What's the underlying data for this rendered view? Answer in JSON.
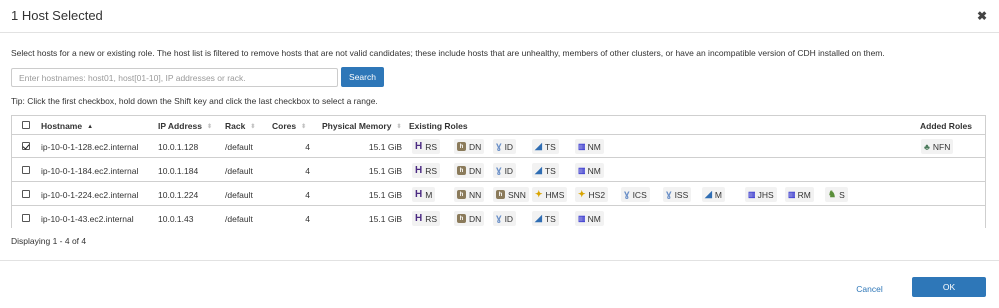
{
  "dialog": {
    "title": "1 Host Selected",
    "close_glyph": "✖",
    "description": "Select hosts for a new or existing role. The host list is filtered to remove hosts that are not valid candidates; these include hosts that are unhealthy, members of other clusters, or have an incompatible version of CDH installed on them.",
    "search": {
      "placeholder": "Enter hostnames: host01, host[01-10], IP addresses or rack.",
      "value": "",
      "button_label": "Search"
    },
    "tip": "Tip: Click the first checkbox, hold down the Shift key and click the last checkbox to select a range.",
    "displaying": "Displaying 1 - 4 of 4",
    "cancel_label": "Cancel",
    "ok_label": "OK"
  },
  "table": {
    "columns": {
      "hostname": "Hostname",
      "ip": "IP Address",
      "rack": "Rack",
      "cores": "Cores",
      "memory": "Physical Memory",
      "existing": "Existing Roles",
      "added": "Added Roles"
    },
    "sort_glyph_active": "▲",
    "sort_glyph": "⬍",
    "rows": [
      {
        "checked": true,
        "hostname": "ip-10-0-1-128.ec2.internal",
        "ip": "10.0.1.128",
        "rack": "/default",
        "cores": "4",
        "memory": "15.1 GiB",
        "roles": [
          {
            "icon": "hbase-icon",
            "glyph": "H",
            "label": "RS"
          },
          {
            "icon": "hdfs-icon",
            "glyph": "h",
            "label": "DN"
          },
          {
            "icon": "zookeeper-icon",
            "glyph": "ɣ",
            "label": "ID"
          },
          {
            "icon": "yarn-icon",
            "glyph": "◢",
            "label": "TS"
          },
          {
            "icon": "mapreduce-icon",
            "glyph": "▥",
            "label": "NM"
          }
        ],
        "added": [
          {
            "icon": "flume-icon",
            "glyph": "♣",
            "label": "NFN"
          }
        ]
      },
      {
        "checked": false,
        "hostname": "ip-10-0-1-184.ec2.internal",
        "ip": "10.0.1.184",
        "rack": "/default",
        "cores": "4",
        "memory": "15.1 GiB",
        "roles": [
          {
            "icon": "hbase-icon",
            "glyph": "H",
            "label": "RS"
          },
          {
            "icon": "hdfs-icon",
            "glyph": "h",
            "label": "DN"
          },
          {
            "icon": "zookeeper-icon",
            "glyph": "ɣ",
            "label": "ID"
          },
          {
            "icon": "yarn-icon",
            "glyph": "◢",
            "label": "TS"
          },
          {
            "icon": "mapreduce-icon",
            "glyph": "▥",
            "label": "NM"
          }
        ],
        "added": []
      },
      {
        "checked": false,
        "hostname": "ip-10-0-1-224.ec2.internal",
        "ip": "10.0.1.224",
        "rack": "/default",
        "cores": "4",
        "memory": "15.1 GiB",
        "roles": [
          {
            "icon": "hbase-icon",
            "glyph": "H",
            "label": "M"
          },
          {
            "icon": "hdfs-icon",
            "glyph": "h",
            "label": "NN"
          },
          {
            "icon": "hdfs-icon",
            "glyph": "h",
            "label": "SNN"
          },
          {
            "icon": "hive-icon",
            "glyph": "✦",
            "label": "HMS"
          },
          {
            "icon": "hive-icon",
            "glyph": "✦",
            "label": "HS2"
          },
          {
            "icon": "zookeeper-icon",
            "glyph": "ɣ",
            "label": "ICS"
          },
          {
            "icon": "zookeeper-icon",
            "glyph": "ɣ",
            "label": "ISS"
          },
          {
            "icon": "yarn-icon",
            "glyph": "◢",
            "label": "M"
          },
          {
            "icon": "mapreduce-icon",
            "glyph": "▥",
            "label": "JHS"
          },
          {
            "icon": "mapreduce-icon",
            "glyph": "▥",
            "label": "RM"
          },
          {
            "icon": "spark-icon",
            "glyph": "♞",
            "label": "S"
          }
        ],
        "added": []
      },
      {
        "checked": false,
        "hostname": "ip-10-0-1-43.ec2.internal",
        "ip": "10.0.1.43",
        "rack": "/default",
        "cores": "4",
        "memory": "15.1 GiB",
        "roles": [
          {
            "icon": "hbase-icon",
            "glyph": "H",
            "label": "RS"
          },
          {
            "icon": "hdfs-icon",
            "glyph": "h",
            "label": "DN"
          },
          {
            "icon": "zookeeper-icon",
            "glyph": "ɣ",
            "label": "ID"
          },
          {
            "icon": "yarn-icon",
            "glyph": "◢",
            "label": "TS"
          },
          {
            "icon": "mapreduce-icon",
            "glyph": "▥",
            "label": "NM"
          }
        ],
        "added": []
      }
    ]
  }
}
